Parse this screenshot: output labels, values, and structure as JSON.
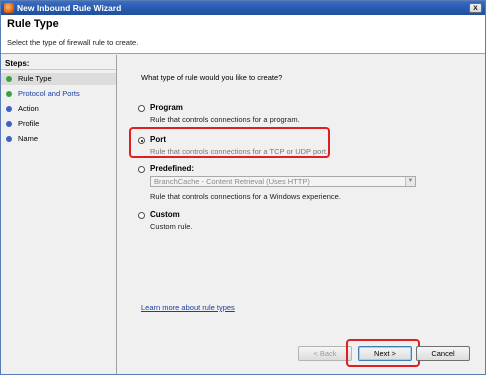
{
  "window": {
    "title": "New Inbound Rule Wizard",
    "close_glyph": "x"
  },
  "header": {
    "title": "Rule Type",
    "subtitle": "Select the type of firewall rule to create."
  },
  "steps": {
    "title": "Steps:",
    "items": [
      {
        "label": "Rule Type",
        "state": "done",
        "current": true
      },
      {
        "label": "Protocol and Ports",
        "state": "done",
        "current": false
      },
      {
        "label": "Action",
        "state": "todo",
        "current": false
      },
      {
        "label": "Profile",
        "state": "todo",
        "current": false
      },
      {
        "label": "Name",
        "state": "todo",
        "current": false
      }
    ]
  },
  "main": {
    "question": "What type of rule would you like to create?",
    "options": [
      {
        "label": "Program",
        "description": "Rule that controls connections for a program.",
        "checked": false
      },
      {
        "label": "Port",
        "description": "Rule that controls connections for a TCP or UDP port.",
        "checked": true
      },
      {
        "label": "Predefined:",
        "select_value": "BranchCache - Content Retrieval (Uses HTTP)",
        "description": "Rule that controls connections for a Windows experience.",
        "checked": false
      },
      {
        "label": "Custom",
        "description": "Custom rule.",
        "checked": false
      }
    ],
    "learn_more": "Learn more about rule types"
  },
  "buttons": {
    "back": "< Back",
    "next": "Next >",
    "cancel": "Cancel"
  },
  "colors": {
    "highlight": "#e02020",
    "title_bar": "#2a5cb0",
    "link": "#1c3fa0"
  }
}
